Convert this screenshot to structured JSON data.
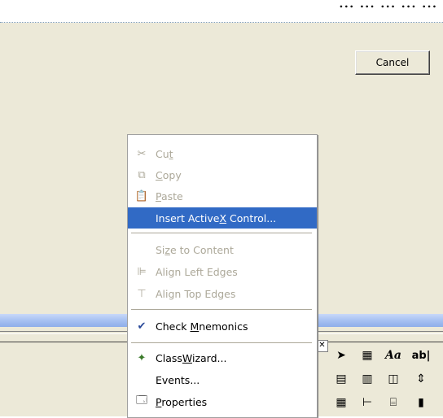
{
  "top_text": "... ... ... ... ... ...",
  "dialog": {
    "cancel_label": "Cancel"
  },
  "context_menu": {
    "items": [
      {
        "label": "Cut",
        "mnemonic": "t",
        "state": "disabled",
        "icon": "scissors-icon"
      },
      {
        "label": "Copy",
        "mnemonic": "C",
        "state": "disabled",
        "icon": "copy-icon"
      },
      {
        "label": "Paste",
        "mnemonic": "P",
        "state": "disabled",
        "icon": "paste-icon"
      },
      {
        "label": "Insert ActiveX Control...",
        "mnemonic": "X",
        "state": "highlighted",
        "icon": ""
      },
      {
        "label": "Size to Content",
        "mnemonic": "z",
        "state": "disabled",
        "icon": ""
      },
      {
        "label": "Align Left Edges",
        "mnemonic": "",
        "state": "disabled",
        "icon": "align-left-icon"
      },
      {
        "label": "Align Top Edges",
        "mnemonic": "",
        "state": "disabled",
        "icon": "align-top-icon"
      },
      {
        "label": "Check Mnemonics",
        "mnemonic": "M",
        "state": "enabled",
        "icon": "check-mnemonics-icon"
      },
      {
        "label": "ClassWizard...",
        "mnemonic": "W",
        "state": "enabled",
        "icon": "class-wizard-icon"
      },
      {
        "label": "Events...",
        "mnemonic": "",
        "state": "enabled",
        "icon": ""
      },
      {
        "label": "Properties",
        "mnemonic": "P",
        "state": "enabled",
        "icon": "properties-icon"
      }
    ]
  },
  "toolbox": {
    "tools": [
      {
        "name": "pointer-tool-icon",
        "glyph": "➤"
      },
      {
        "name": "picture-tool-icon",
        "glyph": "▦"
      },
      {
        "name": "static-text-tool-icon",
        "glyph": "Aa"
      },
      {
        "name": "edit-box-tool-icon",
        "glyph": "ab|"
      },
      {
        "name": "group-box-tool-icon",
        "glyph": "▤"
      },
      {
        "name": "button-tool-icon",
        "glyph": "▥"
      },
      {
        "name": "scrollbar-tool-icon",
        "glyph": "◫"
      },
      {
        "name": "spin-tool-icon",
        "glyph": "⇕"
      },
      {
        "name": "list-tool-icon",
        "glyph": "▦"
      },
      {
        "name": "tree-tool-icon",
        "glyph": "⊢"
      },
      {
        "name": "tab-tool-icon",
        "glyph": "⌸"
      },
      {
        "name": "animate-tool-icon",
        "glyph": "▮"
      }
    ]
  },
  "colors": {
    "highlight": "#316ac5",
    "disabled_text": "#aca899",
    "blue_bar": "#a7c1f2"
  }
}
